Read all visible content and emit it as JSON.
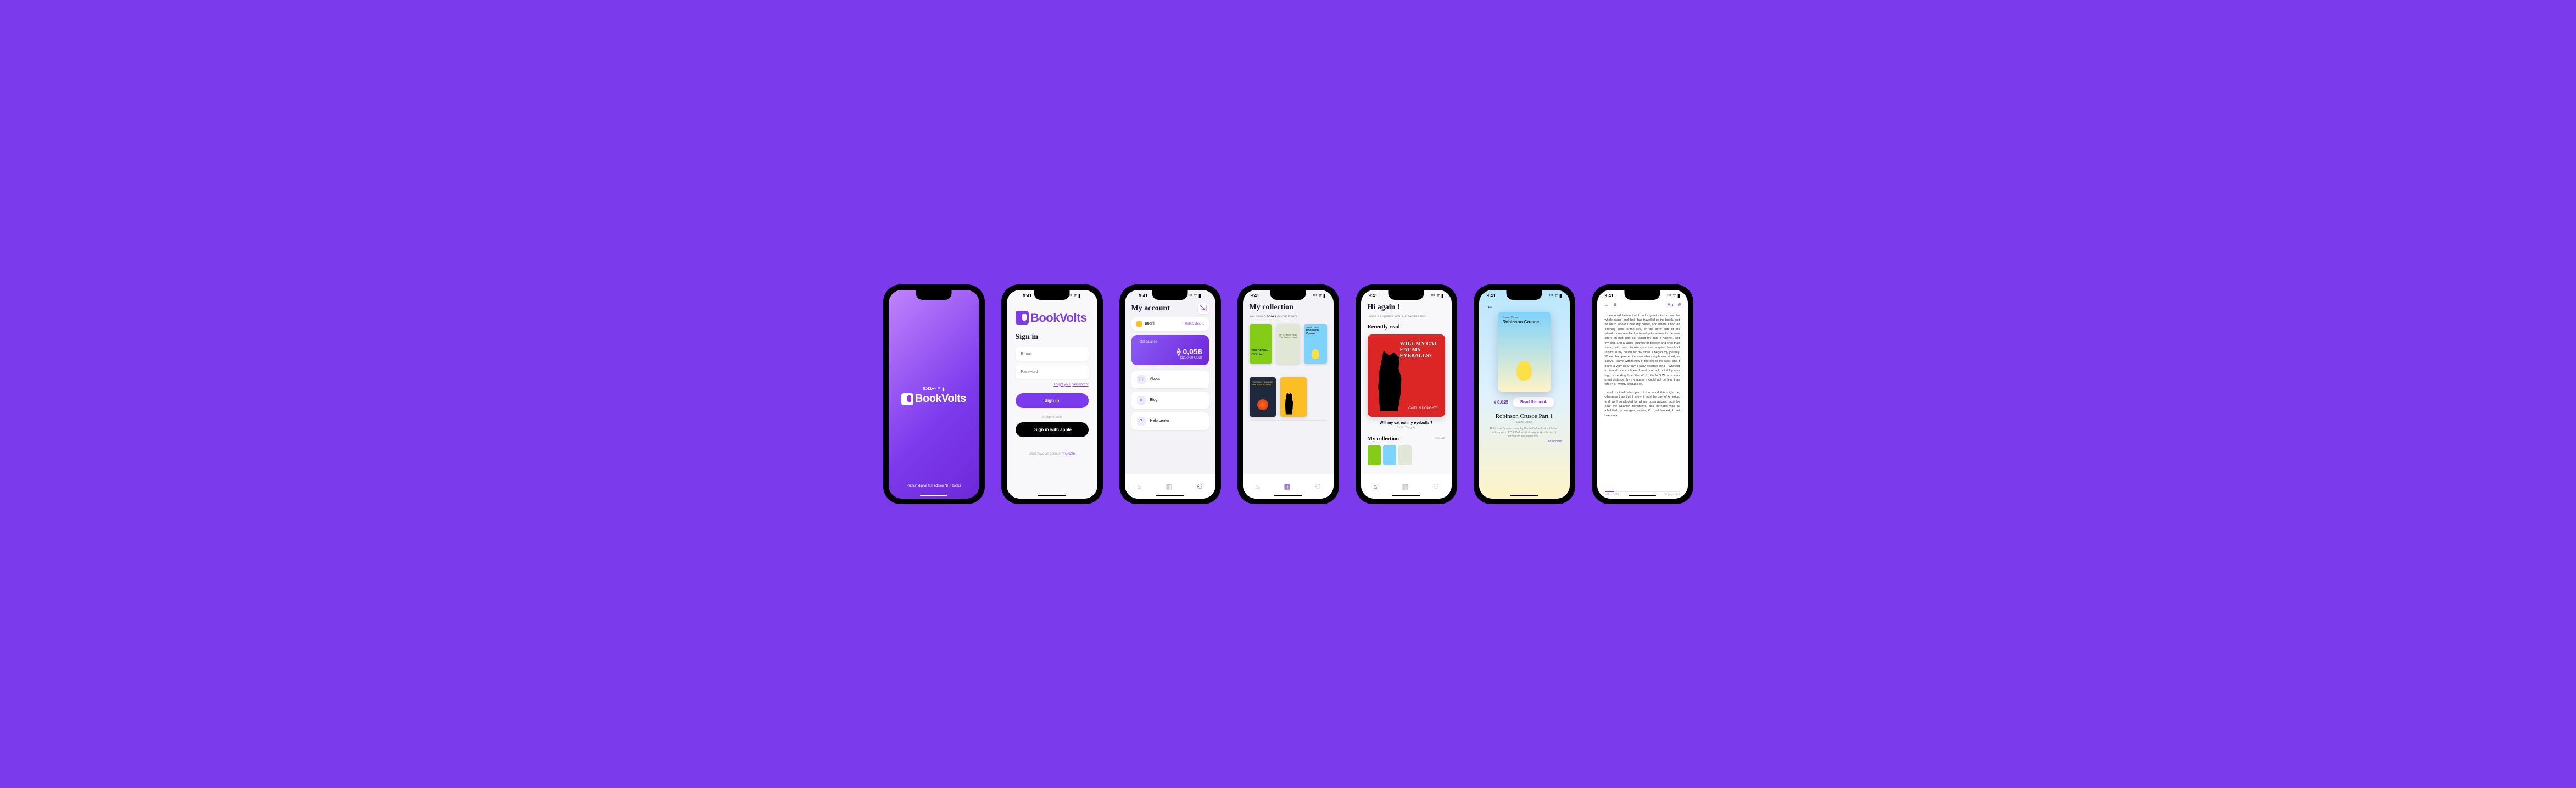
{
  "status": {
    "time": "9:41",
    "signal": "📶",
    "wifi": "📡",
    "battery": "🔋"
  },
  "brand": "BookVolts",
  "splash": {
    "tagline": "Publish digital first edition NFT books"
  },
  "signin": {
    "title": "Sign in",
    "email_ph": "E-mail",
    "password_ph": "Password",
    "forgot": "Forgot your password ?",
    "signin_btn": "Sign in",
    "divider": "or sign in with",
    "apple_btn": "Sign in with apple",
    "noacct": "Don't have an account ? ",
    "create": "Create"
  },
  "account": {
    "title": "My account",
    "username": "andrii",
    "wallet": "0x8852bIcf...",
    "balance_label": "Total balance",
    "balance_amt": "⟠ 0,058",
    "balance_usd": "($230,00 USD)",
    "menu": {
      "about": "About",
      "blog": "Blog",
      "help": "Help center"
    }
  },
  "collection": {
    "title": "My collection",
    "sub_pre": "You have ",
    "sub_count": "5 books",
    "sub_post": " in your library !",
    "books": {
      "design": "THE DESIGN HUSTLE",
      "crusoe_a": "Daniel Defoe",
      "crusoe_t": "Robinson Crusoe",
      "sunshine": "My Sunshine From The Darkest Land",
      "behind": "THE LIGHT BEHIND THE GARDEN WALL"
    }
  },
  "home": {
    "greeting": "Hi again !",
    "sub": "Fusce a vulputate lectus, at facilisis felis.",
    "recently": "Recently read",
    "featured_title": "WILL MY CAT EAT MY EYEBALLS?",
    "featured_author_cover": "CAITLIN DOUGHTY",
    "featured_caption": "Will my cat eat my eyeballs ?",
    "featured_author": "Caitlin Doughty",
    "mycollection": "My collection",
    "seeall": "See All"
  },
  "detail": {
    "cover_author": "Daniel Defoe",
    "cover_title": "Robinson Crusoe",
    "price": "⟠ 0,025",
    "read_btn": "Read the book",
    "title": "Robinson Crusoe Part 1",
    "author": "Daniel Defoe",
    "desc": "Robinson Crusoe, novel by Daniel Defoe, first published in London in 1719. Defoe's first long work of fiction, it introduced two of the mo ...",
    "showmore": "Show more"
  },
  "reader": {
    "p1": "I mentioned before that I had a great mind to see the whole island, and that I had travelled up the brook, and so on to where I built my bower, and where I had an opening quite to the sea, on the other side of the island. I now resolved to travel quite across to the sea-shore on that side; so, taking my gun, a hatchet, and my dog, and a larger quantity of powder and shot than usual, with two biscuit-cakes and a great bunch of raisins in my pouch for my store, I began my journey. When I had passed the vale where my bower stood, as above, I came within view of the sea to the west, and it being a very clear day, I fairly descried land – whether an island or a continent I could not tell; but it lay very high, extending from the W. to the W.S.W. at a very great distance; by my guess it could not be less than fifteen or twenty leagues off.",
    "p2": "I could not tell what part of the world this might be, otherwise than that I knew it must be part of America, and, as I concluded by all my observations, must be near the Spanish dominions, and perhaps was all inhabited by savages, where, if I had landed, I had been in a",
    "page": "167 of 1017",
    "left": "35 pages left"
  }
}
